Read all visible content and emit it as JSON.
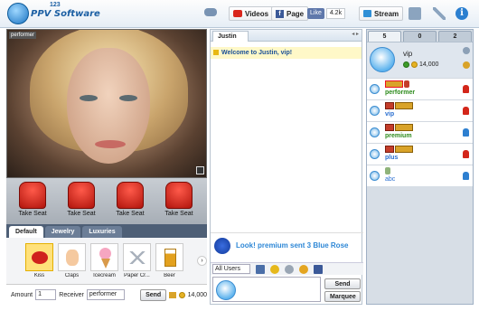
{
  "header": {
    "logo_text": "PPV Software",
    "logo_number": "123",
    "videos_label": "Videos",
    "page_label": "Page",
    "like_label": "Like",
    "like_count": "4.2k",
    "stream_label": "Stream"
  },
  "video": {
    "label": "performer"
  },
  "seats": [
    {
      "label": "Take Seat"
    },
    {
      "label": "Take Seat"
    },
    {
      "label": "Take Seat"
    },
    {
      "label": "Take Seat"
    }
  ],
  "gift_tabs": [
    "Default",
    "Jewelry",
    "Luxuries"
  ],
  "gifts": [
    {
      "label": "Kiss",
      "selected": true
    },
    {
      "label": "Claps"
    },
    {
      "label": "Icecream"
    },
    {
      "label": "Paper Cr..."
    },
    {
      "label": "Beer"
    }
  ],
  "gift_form": {
    "amount_label": "Amount",
    "amount_value": "1",
    "receiver_label": "Receiver",
    "receiver_value": "performer",
    "send_label": "Send",
    "coins": "14,000"
  },
  "chat": {
    "tab_label": "Justin",
    "nav": "◂ ▸",
    "welcome": "Welcome to Justin, vip!",
    "notice": "Look! premium sent 3 Blue Rose",
    "recipient_select": "All Users",
    "send_label": "Send",
    "marquee_label": "Marquee"
  },
  "users_panel": {
    "tabs": [
      {
        "count": "5"
      },
      {
        "count": "0"
      },
      {
        "count": "2"
      }
    ],
    "me": {
      "name": "vip",
      "coins": "14,000"
    },
    "list": [
      {
        "name": "performer",
        "color": "#2b8a1a"
      },
      {
        "name": "vip",
        "color": "#2a6fd0"
      },
      {
        "name": "premium",
        "color": "#2b8a1a"
      },
      {
        "name": "plus",
        "color": "#2a6fd0"
      },
      {
        "name": "abc",
        "color": "#2a6fd0"
      }
    ]
  },
  "colors": {
    "accent": "#1b5fa3",
    "notice": "#2d87d6",
    "seat": "#d3261a"
  }
}
